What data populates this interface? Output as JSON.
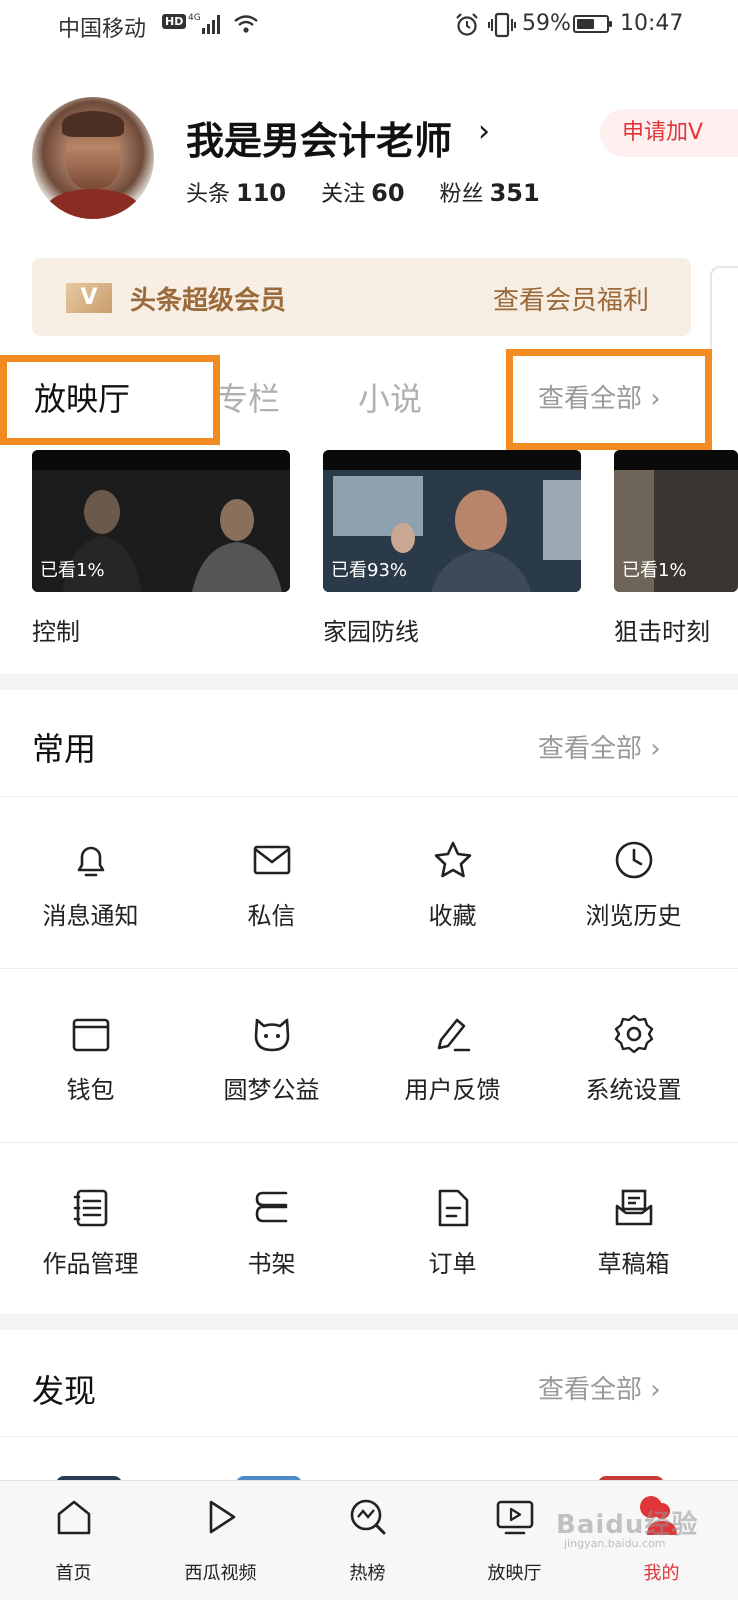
{
  "status_bar": {
    "carrier": "中国移动",
    "hd": "HD",
    "network": "4G",
    "battery_percent": "59%",
    "battery_level": 0.59,
    "time": "10:47"
  },
  "profile": {
    "username": "我是男会计老师",
    "apply_v": "申请加V",
    "stats": [
      {
        "label": "头条",
        "value": "110"
      },
      {
        "label": "关注",
        "value": "60"
      },
      {
        "label": "粉丝",
        "value": "351"
      }
    ]
  },
  "member": {
    "badge": "V",
    "title": "头条超级会员",
    "link": "查看会员福利"
  },
  "tabs": {
    "items": [
      "放映厅",
      "专栏",
      "小说"
    ],
    "active": 0,
    "more": "查看全部 ›"
  },
  "videos": [
    {
      "title": "控制",
      "progress": "已看1%"
    },
    {
      "title": "家园防线",
      "progress": "已看93%"
    },
    {
      "title": "狙击时刻",
      "progress": "已看1%"
    }
  ],
  "common": {
    "title": "常用",
    "more": "查看全部 ›",
    "items": [
      {
        "label": "消息通知",
        "icon": "bell-icon"
      },
      {
        "label": "私信",
        "icon": "mail-icon"
      },
      {
        "label": "收藏",
        "icon": "star-icon"
      },
      {
        "label": "浏览历史",
        "icon": "clock-icon"
      },
      {
        "label": "钱包",
        "icon": "wallet-icon"
      },
      {
        "label": "圆梦公益",
        "icon": "charity-icon"
      },
      {
        "label": "用户反馈",
        "icon": "feedback-pen-icon"
      },
      {
        "label": "系统设置",
        "icon": "gear-icon"
      },
      {
        "label": "作品管理",
        "icon": "notebook-icon"
      },
      {
        "label": "书架",
        "icon": "bookshelf-icon"
      },
      {
        "label": "订单",
        "icon": "document-icon"
      },
      {
        "label": "草稿箱",
        "icon": "drafts-icon"
      }
    ]
  },
  "discover": {
    "title": "发现",
    "more": "查看全部 ›"
  },
  "bottom_nav": {
    "items": [
      {
        "label": "首页",
        "icon": "home-icon"
      },
      {
        "label": "西瓜视频",
        "icon": "play-icon"
      },
      {
        "label": "热榜",
        "icon": "trending-icon"
      },
      {
        "label": "放映厅",
        "icon": "tv-play-icon"
      },
      {
        "label": "我的",
        "icon": "profile-icon"
      }
    ],
    "active": 4
  },
  "watermark": {
    "brand": "Baidu经验",
    "url": "jingyan.baidu.com"
  },
  "colors": {
    "accent_red": "#e0353a",
    "member_gold": "#9b6a3a",
    "highlight_orange": "#f28b22"
  }
}
